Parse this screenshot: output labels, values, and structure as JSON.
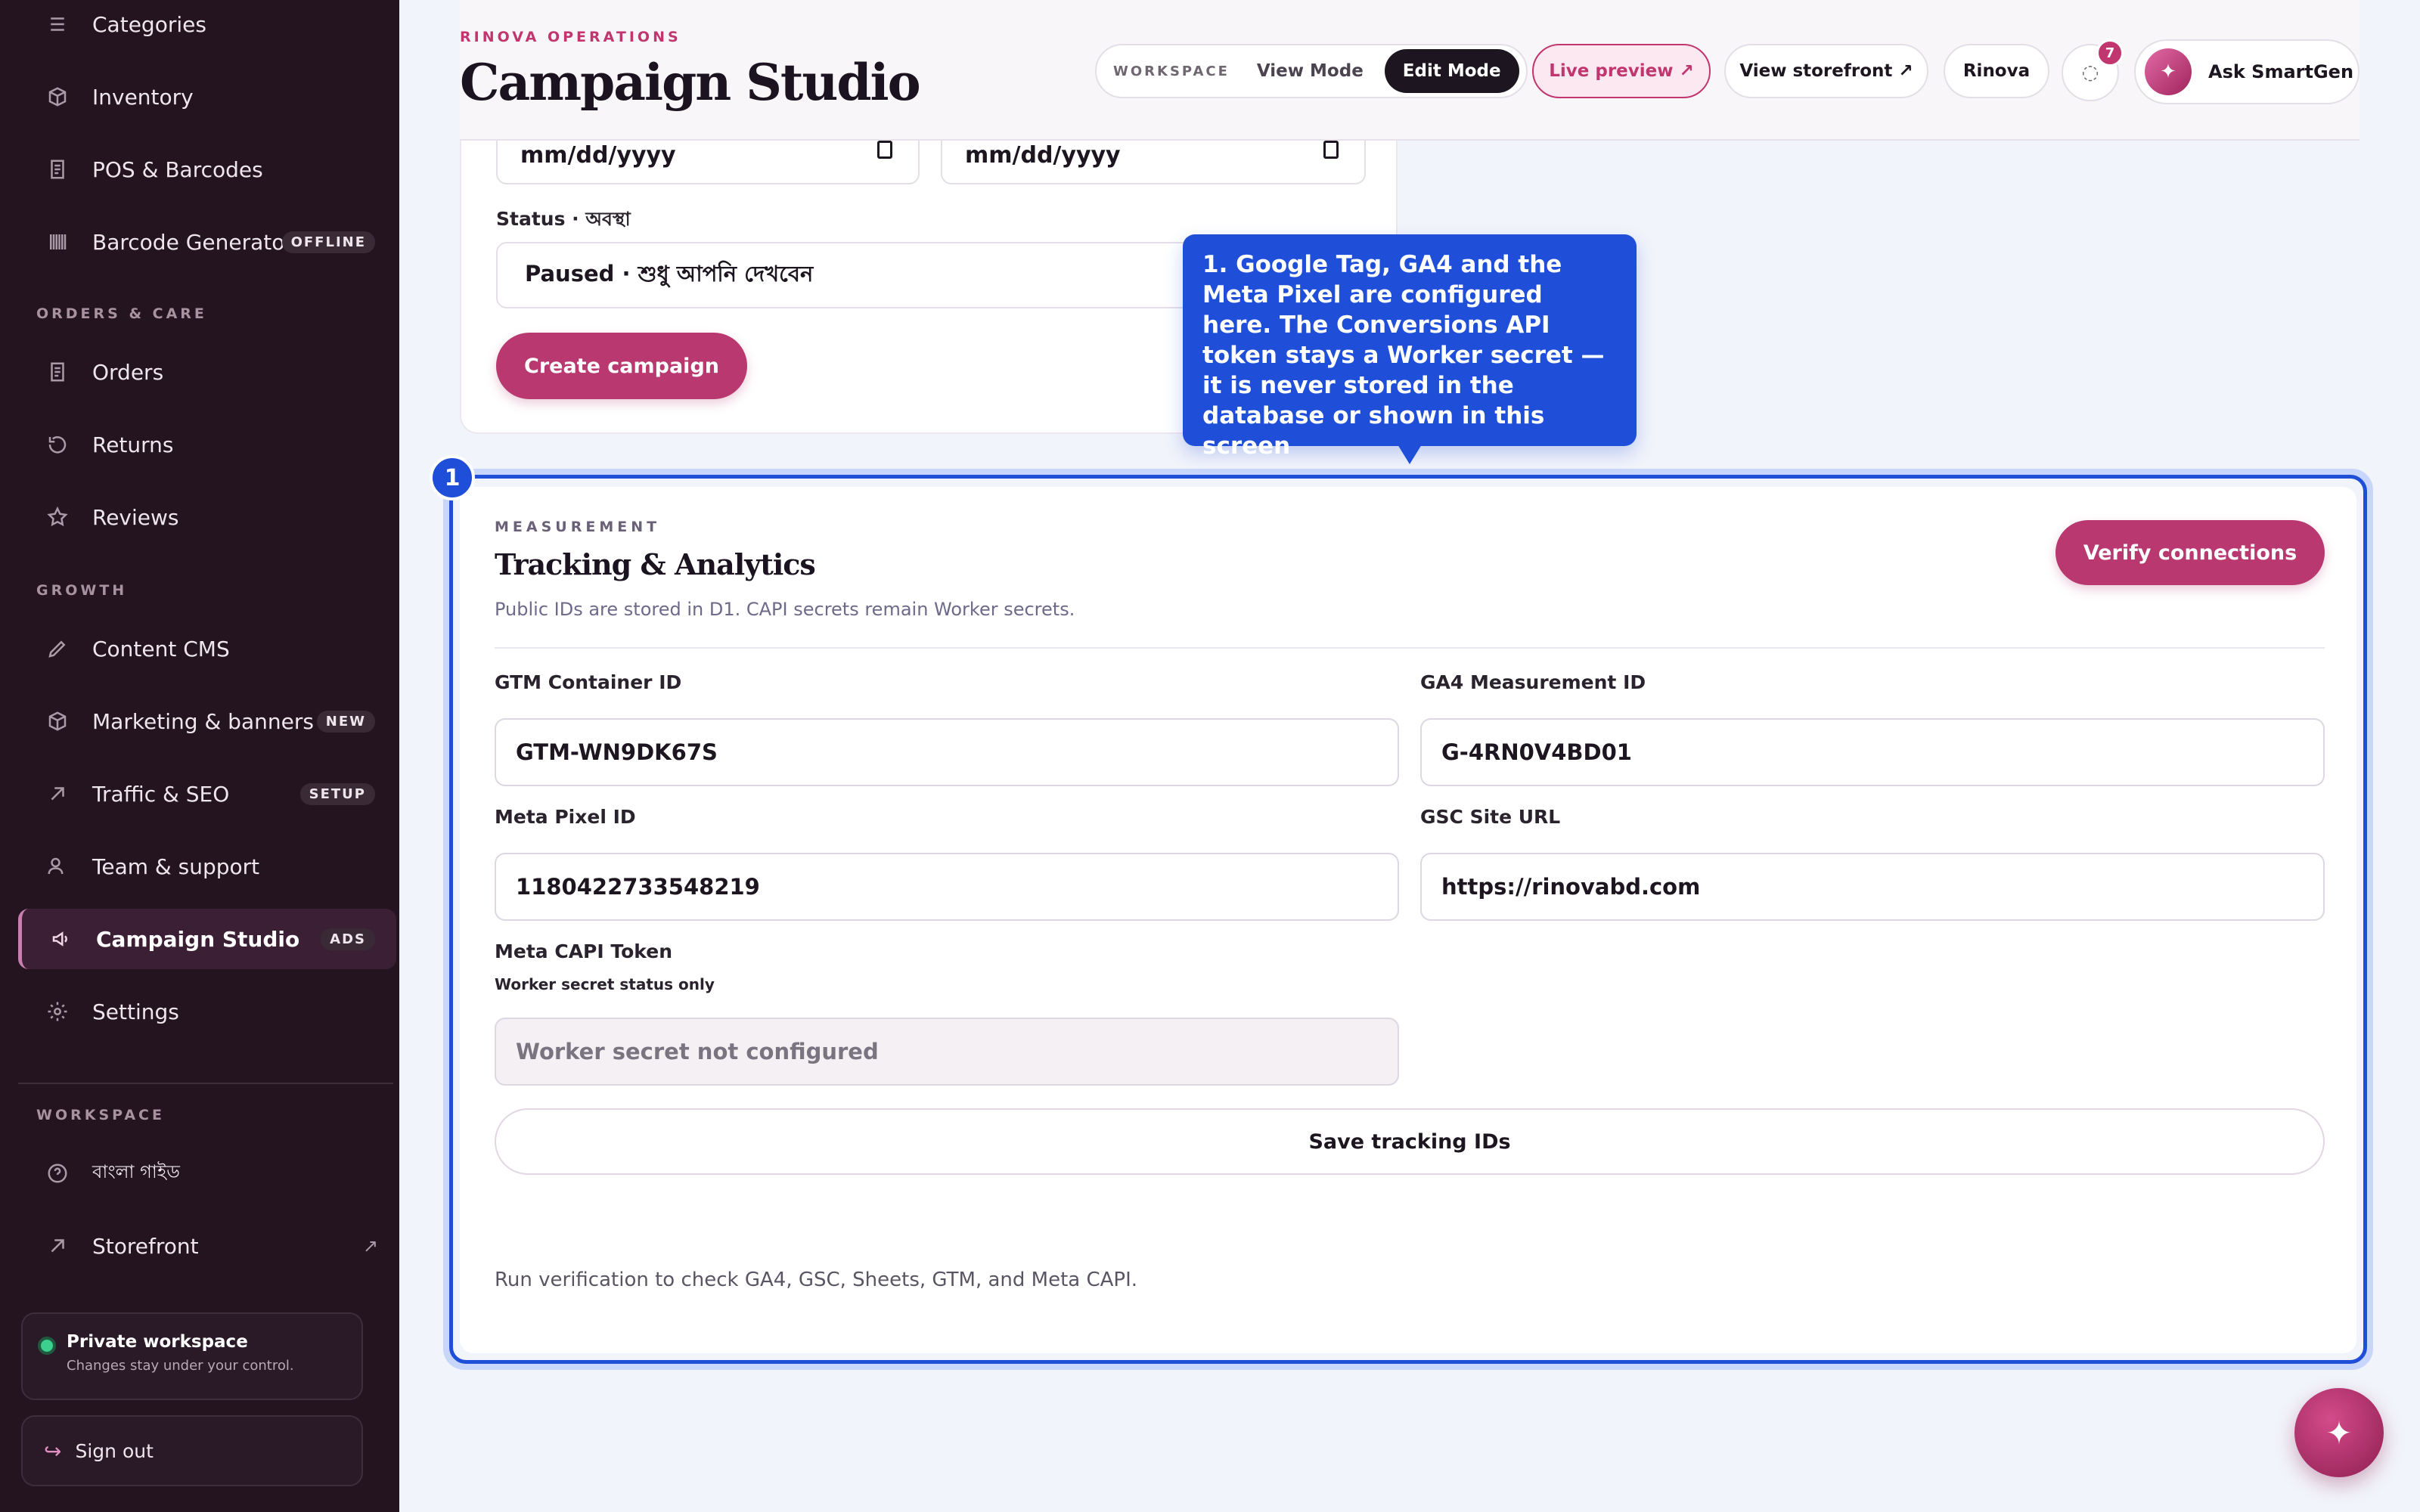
{
  "sidebar": {
    "items": [
      {
        "label": "Categories",
        "icon": "list-icon"
      },
      {
        "label": "Inventory",
        "icon": "box-icon"
      },
      {
        "label": "POS & Barcodes",
        "icon": "receipt-icon"
      },
      {
        "label": "Barcode Generator",
        "icon": "barcode-icon",
        "badge": "OFFLINE"
      },
      {
        "label": "Orders",
        "icon": "receipt-icon"
      },
      {
        "label": "Returns",
        "icon": "refresh-icon"
      },
      {
        "label": "Reviews",
        "icon": "star-icon"
      },
      {
        "label": "Content CMS",
        "icon": "pencil-icon"
      },
      {
        "label": "Marketing & banners",
        "icon": "box-icon",
        "badge": "NEW"
      },
      {
        "label": "Traffic & SEO",
        "icon": "arrow-up-right-icon",
        "badge": "SETUP"
      },
      {
        "label": "Team & support",
        "icon": "users-icon"
      },
      {
        "label": "Campaign Studio",
        "icon": "megaphone-icon",
        "badge": "ADS",
        "active": true
      },
      {
        "label": "Settings",
        "icon": "gear-icon"
      },
      {
        "label": "বাংলা গাইড",
        "icon": "help-circle-icon"
      },
      {
        "label": "Storefront",
        "icon": "arrow-up-right-icon",
        "trailing": "↗"
      }
    ],
    "sections": {
      "orders": "ORDERS & CARE",
      "growth": "GROWTH",
      "workspace": "WORKSPACE"
    },
    "private_card": {
      "title": "Private workspace",
      "subtitle": "Changes stay under your control."
    },
    "sign_out": "Sign out"
  },
  "header": {
    "eyebrow": "RINOVA OPERATIONS",
    "title": "Campaign Studio",
    "mode": {
      "workspace": "WORKSPACE",
      "view": "View Mode",
      "edit": "Edit Mode"
    },
    "live_preview": "Live preview ↗",
    "view_storefront": "View storefront ↗",
    "store_name": "Rinova",
    "notification_count": "7",
    "ask": "Ask SmartGen"
  },
  "campaign_form": {
    "start_date_placeholder": "mm/dd/yyyy",
    "end_date_placeholder": "mm/dd/yyyy",
    "status_label": "Status · অবস্থা",
    "status_value": "Paused · শুধু আপনি দেখবেন",
    "create_button": "Create campaign"
  },
  "tooltip": {
    "text": "1. Google Tag, GA4 and the Meta Pixel are configured here. The Conversions API token stays a Worker secret — it is never stored in the database or shown in this screen",
    "step": "1"
  },
  "tracking": {
    "eyebrow": "MEASUREMENT",
    "title": "Tracking & Analytics",
    "subtitle": "Public IDs are stored in D1. CAPI secrets remain Worker secrets.",
    "verify_button": "Verify connections",
    "fields": {
      "gtm_label": "GTM Container ID",
      "gtm_value": "GTM-WN9DK67S",
      "ga4_label": "GA4 Measurement ID",
      "ga4_value": "G-4RN0V4BD01",
      "pixel_label": "Meta Pixel ID",
      "pixel_value": "1180422733548219",
      "gsc_label": "GSC Site URL",
      "gsc_value": "https://rinovabd.com",
      "capi_label": "Meta CAPI Token",
      "capi_sublabel": "Worker secret status only",
      "capi_value": "Worker secret not configured"
    },
    "save_button": "Save tracking IDs",
    "verify_note": "Run verification to check GA4, GSC, Sheets, GTM, and Meta CAPI."
  },
  "colors": {
    "accent": "#b8386f",
    "highlight": "#1f4fd8",
    "sidebar_bg": "#231420"
  }
}
